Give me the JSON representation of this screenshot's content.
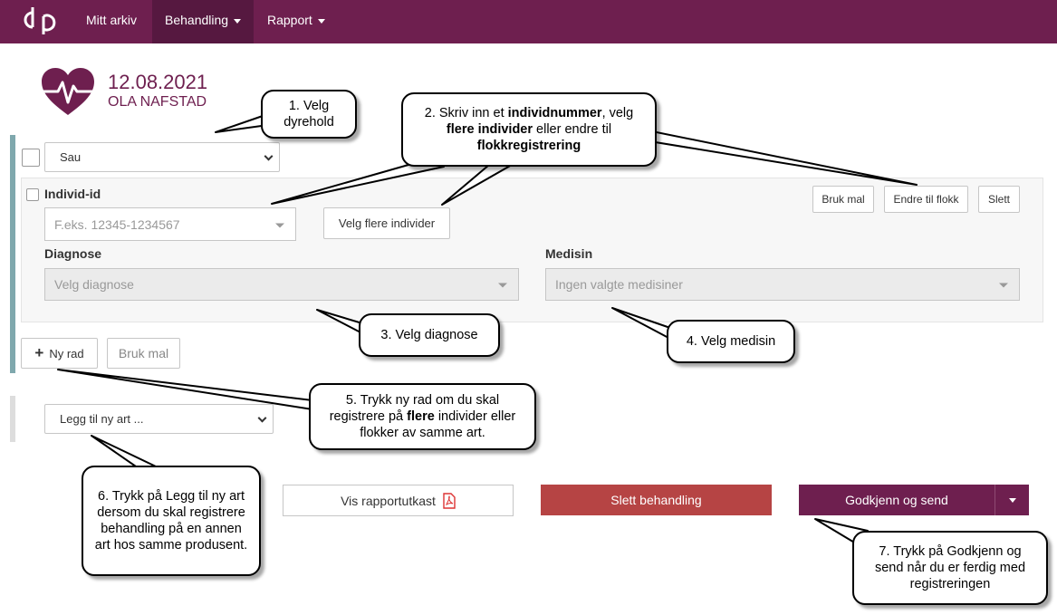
{
  "nav": {
    "logo_icon": "dp-logo-icon",
    "items": [
      {
        "label": "Mitt arkiv"
      },
      {
        "label": "Behandling"
      },
      {
        "label": "Rapport"
      }
    ]
  },
  "header": {
    "icon": "heart-pulse-icon",
    "date": "12.08.2021",
    "owner": "OLA NAFSTAD"
  },
  "species_select": {
    "value": "Sau"
  },
  "row": {
    "individ_label": "Individ-id",
    "individ_placeholder": "F.eks. 12345-1234567",
    "velg_flere_label": "Velg flere individer",
    "bruk_mal_label": "Bruk mal",
    "endre_label": "Endre til flokk",
    "slett_label": "Slett",
    "diagnose_label": "Diagnose",
    "diagnose_placeholder": "Velg diagnose",
    "medisin_label": "Medisin",
    "medisin_placeholder": "Ingen valgte medisiner"
  },
  "row_actions": {
    "ny_rad_label": "Ny rad",
    "bruk_mal_label": "Bruk mal"
  },
  "add_species_select": {
    "value": "Legg til ny art ..."
  },
  "footer": {
    "vis_label": "Vis rapportutkast",
    "slett_label": "Slett behandling",
    "godkjenn_label": "Godkjenn og send"
  },
  "callouts": {
    "c1": {
      "text": "1. Velg dyrehold"
    },
    "c2": {
      "pre": "2. Skriv inn et ",
      "bold1": "individnummer",
      "mid1": ", velg ",
      "bold2": "flere individer",
      "mid2": " eller endre til ",
      "bold3": "flokkregistrering"
    },
    "c3": {
      "text": "3. Velg diagnose"
    },
    "c4": {
      "text": "4. Velg medisin"
    },
    "c5": {
      "pre": "5. Trykk ny rad om du skal registrere på ",
      "bold": "flere",
      "post": " individer eller flokker av samme art."
    },
    "c6": {
      "text": "6. Trykk på Legg til ny art dersom du skal registrere behandling på en annen art hos samme produsent."
    },
    "c7": {
      "text": "7. Trykk på Godkjenn og send når du er ferdig med registreringen"
    }
  },
  "colors": {
    "brand": "#6e1f4f",
    "brand_dark": "#561840",
    "danger": "#b64444",
    "accent_bar": "#7fa8ad"
  }
}
